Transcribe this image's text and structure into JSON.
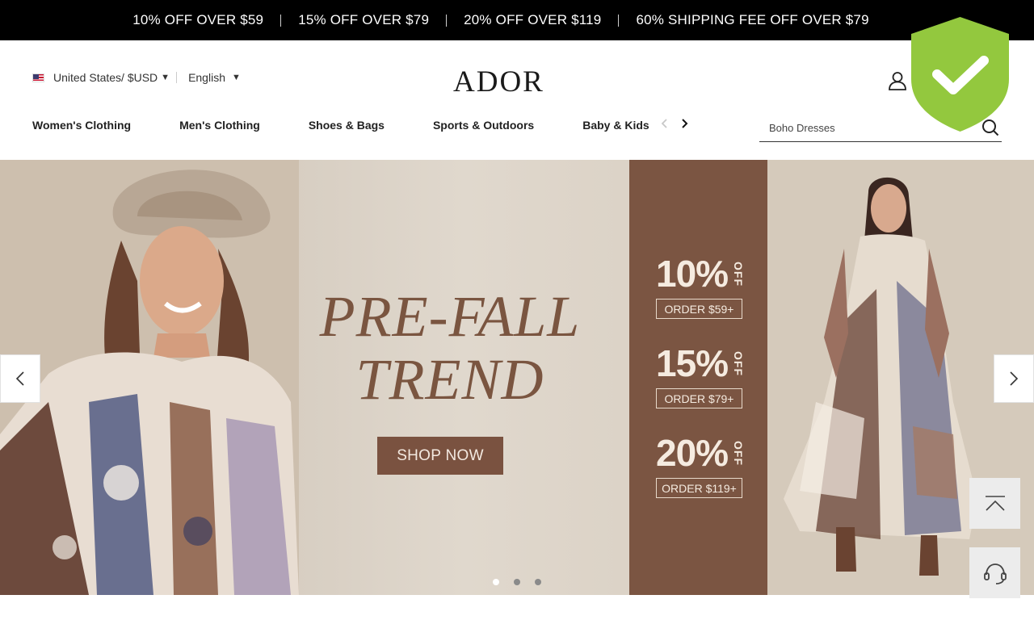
{
  "promo_bar": {
    "items": [
      "10% OFF OVER $59",
      "15% OFF OVER $79",
      "20% OFF OVER $119",
      "60% SHIPPING FEE OFF OVER $79"
    ]
  },
  "header": {
    "region": "United States/ $USD",
    "language": "English",
    "logo": "ADOR",
    "icons": {
      "account": "user-icon",
      "search": "search-icon",
      "badge": "shield-check-icon"
    }
  },
  "nav": {
    "items": [
      "Women's Clothing",
      "Men's Clothing",
      "Shoes & Bags",
      "Sports & Outdoors",
      "Baby & Kids"
    ]
  },
  "search": {
    "placeholder": "Boho Dresses"
  },
  "hero": {
    "title_line1": "PRE-FALL",
    "title_line2": "TREND",
    "cta": "SHOP NOW",
    "offers": [
      {
        "percent": "10%",
        "off": "OFF",
        "order": "ORDER $59+"
      },
      {
        "percent": "15%",
        "off": "OFF",
        "order": "ORDER $79+"
      },
      {
        "percent": "20%",
        "off": "OFF",
        "order": "ORDER $119+"
      }
    ],
    "slides_count": 3,
    "active_slide": 1
  },
  "colors": {
    "promo_bg": "#000000",
    "brand_brown": "#7b5542",
    "shield_green": "#93c83e"
  }
}
